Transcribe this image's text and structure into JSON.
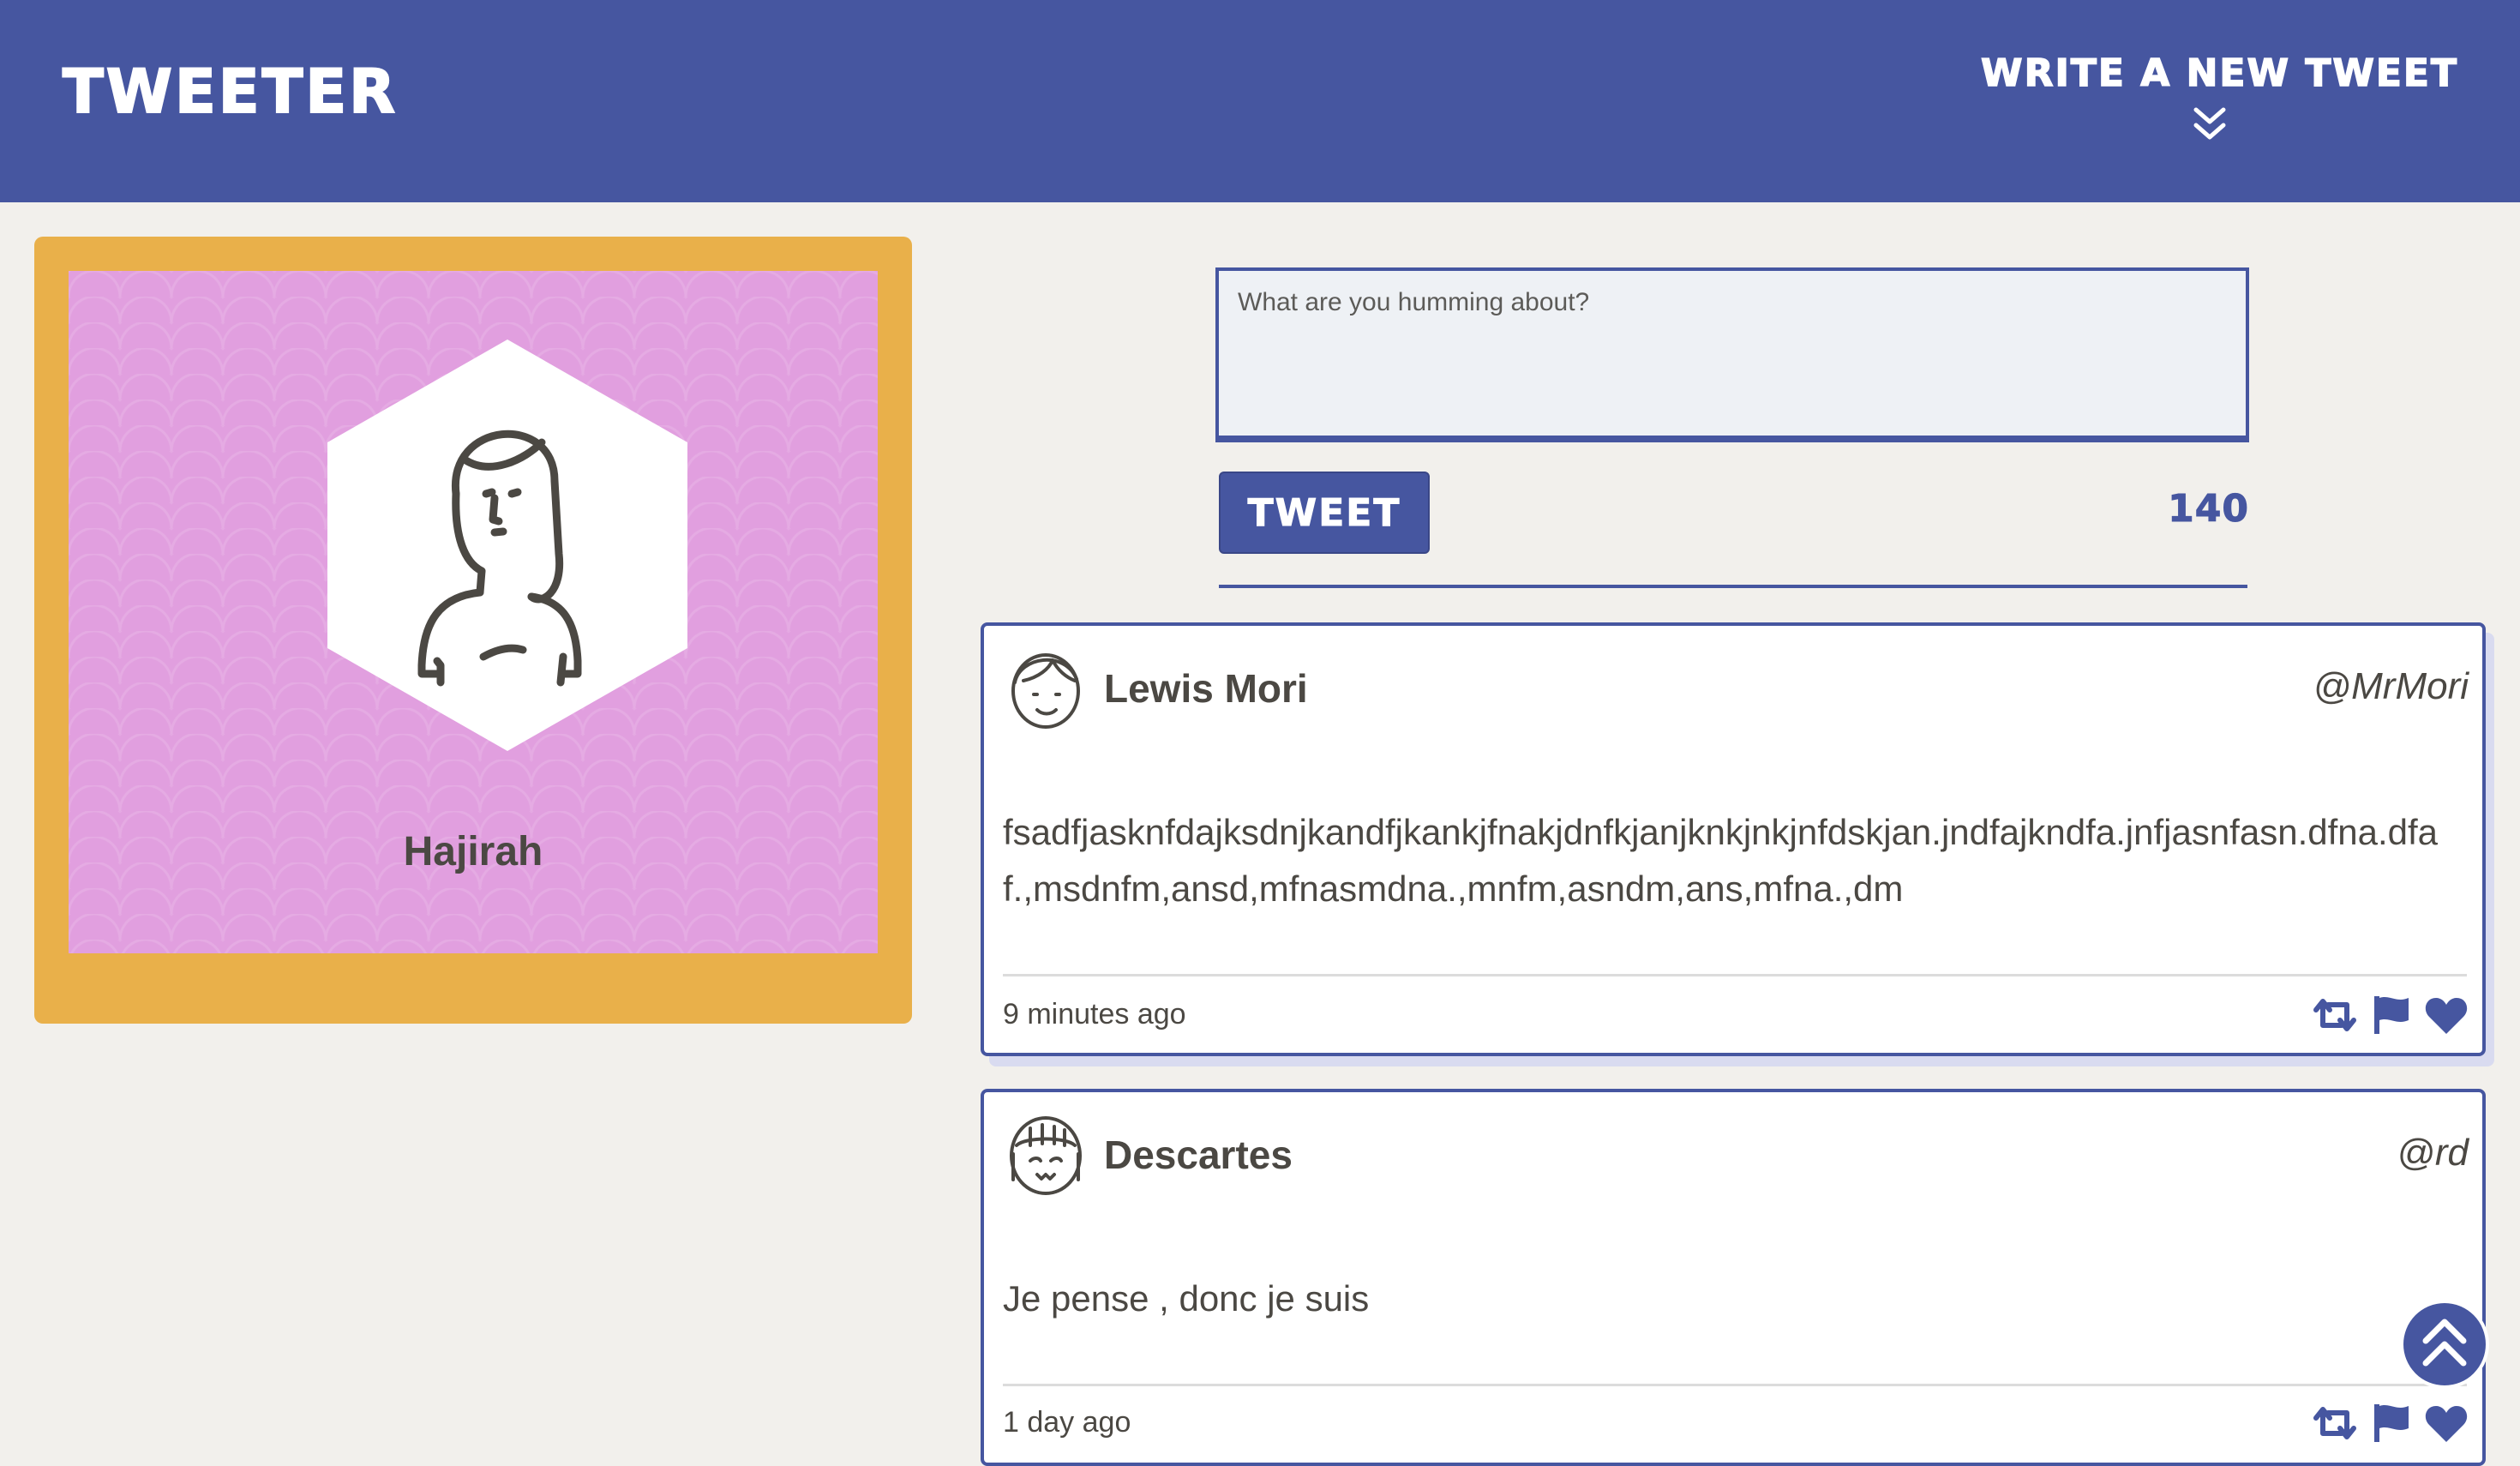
{
  "header": {
    "brand": "Tweeter",
    "compose_toggle_label": "Write a new tweet",
    "compose_toggle_icon": "double-chevron-down-icon"
  },
  "profile": {
    "name": "Hajirah",
    "avatar_icon": "woman-avatar-icon"
  },
  "composer": {
    "placeholder": "What are you humming about?",
    "value": "",
    "submit_label": "Tweet",
    "char_counter": "140"
  },
  "tweets": [
    {
      "author": "Lewis Mori",
      "handle": "@MrMori",
      "avatar_icon": "man-avatar-icon",
      "text": "fsadfjasknfdajksdnjkandfjkankjfnakjdnfkjanjknkjnkjnfdskjan.jndfajkndfa.jnfjasnfasn.dfna.dfaf.,msdnfm,ansd,mfnasmdna.,mnfm,asndm,ans,mfna.,dm",
      "time": "9 minutes ago",
      "actions": [
        "retweet-icon",
        "flag-icon",
        "heart-icon"
      ]
    },
    {
      "author": "Descartes",
      "handle": "@rd",
      "avatar_icon": "girl-avatar-icon",
      "text": "Je pense , donc je suis",
      "time": "1 day ago",
      "actions": [
        "retweet-icon",
        "flag-icon",
        "heart-icon"
      ]
    }
  ],
  "scroll_top_icon": "double-chevron-up-icon",
  "colors": {
    "nav": "#4656a0",
    "background": "#f2f0ec",
    "profile_frame": "#e9b04a",
    "profile_panel": "#e19fdf",
    "text": "#4b4843"
  }
}
